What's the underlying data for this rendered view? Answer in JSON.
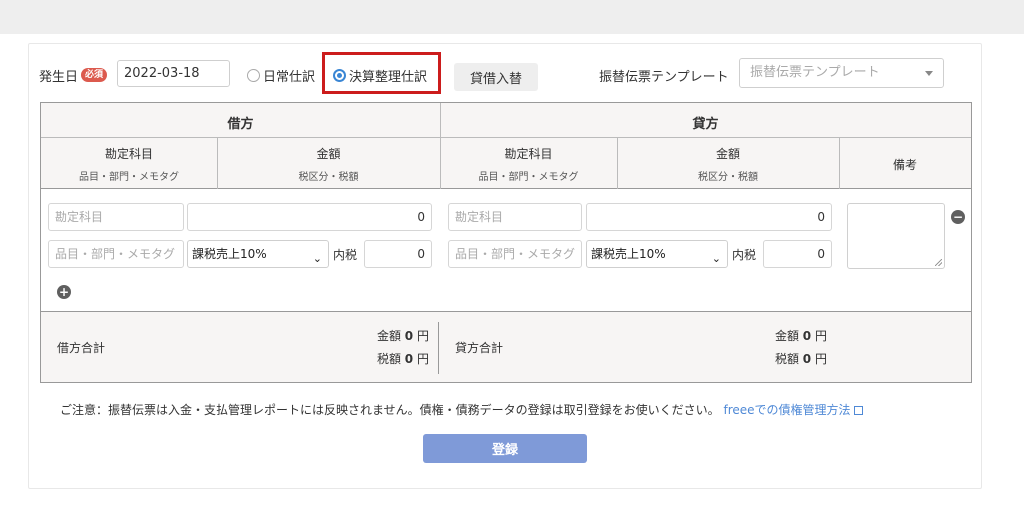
{
  "form": {
    "date_label": "発生日",
    "required_badge": "必須",
    "date_value": "2022-03-18",
    "radio_daily": "日常仕訳",
    "radio_closing": "決算整理仕訳",
    "swap_button": "貸借入替",
    "template_label": "振替伝票テンプレート",
    "template_placeholder": "振替伝票テンプレート"
  },
  "table": {
    "debit_title": "借方",
    "credit_title": "貸方",
    "col_account": "勘定科目",
    "col_account_sub": "品目・部門・メモタグ",
    "col_amount": "金額",
    "col_amount_sub": "税区分・税額",
    "col_remarks": "備考",
    "row": {
      "debit_account_placeholder": "勘定科目",
      "debit_amount": "0",
      "debit_tags_placeholder": "品目・部門・メモタグ",
      "debit_tax_select": "課税売上10%",
      "debit_tax_label": "内税",
      "debit_tax_value": "0",
      "credit_account_placeholder": "勘定科目",
      "credit_amount": "0",
      "credit_tags_placeholder": "品目・部門・メモタグ",
      "credit_tax_select": "課税売上10%",
      "credit_tax_label": "内税",
      "credit_tax_value": "0"
    },
    "totals": {
      "debit_label": "借方合計",
      "credit_label": "貸方合計",
      "amount_label": "金額",
      "tax_label": "税額",
      "debit_amount": "0",
      "debit_tax": "0",
      "credit_amount": "0",
      "credit_tax": "0",
      "currency": "円"
    }
  },
  "notice": {
    "text": "ご注意：振替伝票は入金・支払管理レポートには反映されません。債権・債務データの登録は取引登録をお使いください。",
    "link": "freeeでの債権管理方法"
  },
  "submit_button": "登録",
  "colors": {
    "highlight_red": "#cc1c1c",
    "radio_blue": "#3a86d4",
    "submit_blue": "#7f9ad8",
    "link_blue": "#4f89d6",
    "required_red": "#dc5a4e"
  }
}
